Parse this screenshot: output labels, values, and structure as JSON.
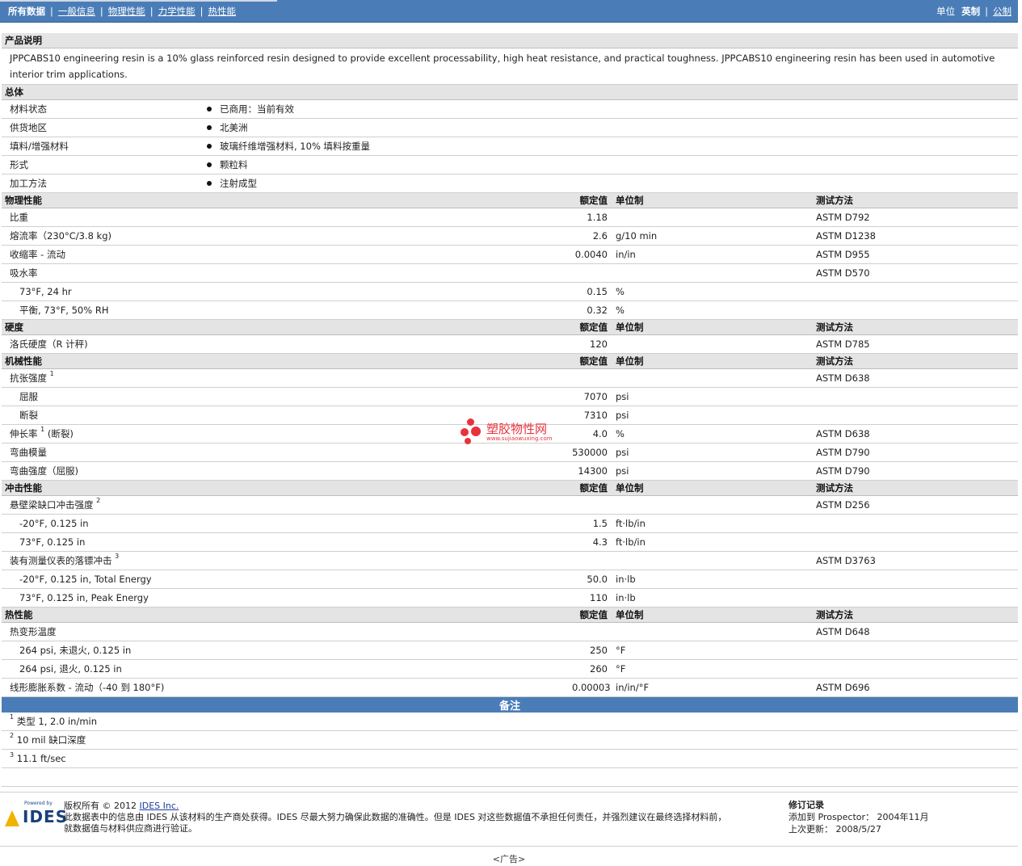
{
  "nav": {
    "tabs": [
      {
        "label": "所有数据",
        "active": true
      },
      {
        "label": "一般信息",
        "active": false
      },
      {
        "label": "物理性能",
        "active": false
      },
      {
        "label": "力学性能",
        "active": false
      },
      {
        "label": "热性能",
        "active": false
      }
    ],
    "unit_label": "单位",
    "unit_imperial": "英制",
    "unit_metric": "公制"
  },
  "sections": {
    "description": {
      "title": "产品说明",
      "text": "JPPCABS10 engineering resin is a 10% glass reinforced resin designed to provide excellent processability, high heat resistance, and practical toughness. JPPCABS10 engineering resin has been used in automotive interior trim applications."
    },
    "general": {
      "title": "总体",
      "rows": [
        {
          "name": "材料状态",
          "value": "已商用：当前有效"
        },
        {
          "name": "供货地区",
          "value": "北美洲"
        },
        {
          "name": "填料/增强材料",
          "value": "玻璃纤维增强材料, 10% 填料按重量"
        },
        {
          "name": "形式",
          "value": "颗粒料"
        },
        {
          "name": "加工方法",
          "value": "注射成型"
        }
      ]
    },
    "columns": {
      "nominal": "额定值",
      "unit": "单位制",
      "method": "测试方法"
    },
    "physical": {
      "title": "物理性能",
      "rows": [
        {
          "name": "比重",
          "value": "1.18",
          "unit": "",
          "method": "ASTM D792"
        },
        {
          "name": "熔流率（230°C/3.8 kg)",
          "value": "2.6",
          "unit": "g/10 min",
          "method": "ASTM D1238"
        },
        {
          "name": "收缩率 - 流动",
          "value": "0.0040",
          "unit": "in/in",
          "method": "ASTM D955"
        },
        {
          "name": "吸水率",
          "value": "",
          "unit": "",
          "method": "ASTM D570"
        },
        {
          "name": "73°F, 24 hr",
          "value": "0.15",
          "unit": "%",
          "method": "",
          "sub": true
        },
        {
          "name": "平衡, 73°F, 50% RH",
          "value": "0.32",
          "unit": "%",
          "method": "",
          "sub": true
        }
      ]
    },
    "hardness": {
      "title": "硬度",
      "rows": [
        {
          "name": "洛氏硬度（R 计秤)",
          "value": "120",
          "unit": "",
          "method": "ASTM D785"
        }
      ]
    },
    "mechanical": {
      "title": "机械性能",
      "rows": [
        {
          "name": "抗张强度",
          "note": "1",
          "value": "",
          "unit": "",
          "method": "ASTM D638"
        },
        {
          "name": "屈服",
          "value": "7070",
          "unit": "psi",
          "method": "",
          "sub": true
        },
        {
          "name": "断裂",
          "value": "7310",
          "unit": "psi",
          "method": "",
          "sub": true
        },
        {
          "name": "伸长率",
          "note": "1",
          "suffix": "(断裂)",
          "value": "4.0",
          "unit": "%",
          "method": "ASTM D638"
        },
        {
          "name": "弯曲模量",
          "value": "530000",
          "unit": "psi",
          "method": "ASTM D790"
        },
        {
          "name": "弯曲强度（屈服)",
          "value": "14300",
          "unit": "psi",
          "method": "ASTM D790"
        }
      ]
    },
    "impact": {
      "title": "冲击性能",
      "rows": [
        {
          "name": "悬壁梁缺口冲击强度",
          "note": "2",
          "value": "",
          "unit": "",
          "method": "ASTM D256"
        },
        {
          "name": "-20°F, 0.125 in",
          "value": "1.5",
          "unit": "ft·lb/in",
          "method": "",
          "sub": true
        },
        {
          "name": "73°F, 0.125 in",
          "value": "4.3",
          "unit": "ft·lb/in",
          "method": "",
          "sub": true
        },
        {
          "name": "装有测量仪表的落镖冲击",
          "note": "3",
          "value": "",
          "unit": "",
          "method": "ASTM D3763"
        },
        {
          "name": "-20°F, 0.125 in, Total Energy",
          "value": "50.0",
          "unit": "in·lb",
          "method": "",
          "sub": true
        },
        {
          "name": "73°F, 0.125 in, Peak Energy",
          "value": "110",
          "unit": "in·lb",
          "method": "",
          "sub": true
        }
      ]
    },
    "thermal": {
      "title": "热性能",
      "rows": [
        {
          "name": "热变形温度",
          "value": "",
          "unit": "",
          "method": "ASTM D648"
        },
        {
          "name": "264 psi, 未退火, 0.125 in",
          "value": "250",
          "unit": "°F",
          "method": "",
          "sub": true
        },
        {
          "name": "264 psi, 退火, 0.125 in",
          "value": "260",
          "unit": "°F",
          "method": "",
          "sub": true
        },
        {
          "name": "线形膨胀系数 - 流动（-40 到 180°F)",
          "value": "0.000032",
          "unit": "in/in/°F",
          "method": "ASTM D696"
        }
      ]
    },
    "notes": {
      "title": "备注",
      "rows": [
        {
          "num": "1",
          "text": "类型 1, 2.0 in/min"
        },
        {
          "num": "2",
          "text": "10 mil 缺口深度"
        },
        {
          "num": "3",
          "text": "11.1 ft/sec"
        }
      ]
    }
  },
  "watermark": {
    "text": "塑胶物性网",
    "url": "www.sujiaowuxing.com"
  },
  "footer": {
    "logo_powered": "Powered by",
    "logo_text": "IDES",
    "copyright_prefix": "版权所有 © 2012",
    "company_link": "IDES Inc.",
    "disclaimer_line1": "此数据表中的信息由 IDES 从该材料的生产商处获得。IDES 尽最大努力确保此数据的准确性。但是 IDES 对这些数据值不承担任何责任，并强烈建议在最终选择材料前，",
    "disclaimer_line2": "就数据值与材料供应商进行验证。",
    "revision_title": "修订记录",
    "added_label": "添加到 Prospector：",
    "added_date": "2004年11月",
    "updated_label": "上次更新：",
    "updated_date": "2008/5/27",
    "ad_text": "<广告>"
  }
}
